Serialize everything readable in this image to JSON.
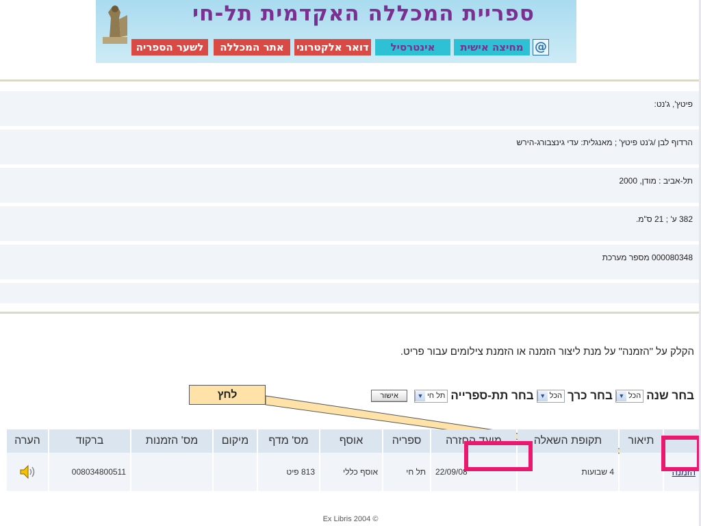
{
  "banner": {
    "title": "ספריית המכללה האקדמית תל-חי",
    "nav": [
      "לשער הספריה",
      "אתר המכללה",
      "דואר אלקטרוני",
      "אינטרסיל",
      "מחיצה אישית"
    ],
    "at_symbol": "@"
  },
  "record": {
    "author": "פיטץ', ג'נט:",
    "title_statement": "הרדוף לבן /ג'נט פיטץ' ; מאנגלית: עדי גינצבורג-הירש",
    "publication": "תל-אביב : מודן, 2000",
    "physical": "382 ע' ; 21 ס\"מ.",
    "system_number": "000080348 מספר מערכת"
  },
  "instructions": "הקלק על \"הזמנה\" על מנת ליצור הזמנה או הזמנת צילומים עבור פריט.",
  "filters": {
    "year_label": "בחר שנה",
    "year_value": "הכל",
    "volume_label": "בחר כרך",
    "volume_value": "הכל",
    "sublibrary_label": "בחר תת-ספרייה",
    "sublibrary_value": "תל חי",
    "confirm": "אישור"
  },
  "callout": "לחץ",
  "table": {
    "headers": [
      "",
      "תיאור",
      "תקופת השאלה",
      "מועד החזרה",
      "ספריה",
      "אוסף",
      "מס' מדף",
      "מיקום",
      "מס' הזמנות",
      "ברקוד",
      "הערה"
    ],
    "row": {
      "request_link": "הזמנה",
      "description": "",
      "loan_period": "4 שבועות",
      "due_date": "22/09/08",
      "library": "תל חי",
      "collection": "אוסף כללי",
      "shelf": "813 פיט",
      "location": "",
      "requests": "",
      "barcode": "008034800511",
      "note": ""
    }
  },
  "footer": "Ex Libris 2004 ©",
  "colors": {
    "banner_title": "#7b2f90",
    "nav_red": "#d84a43",
    "nav_aqua": "#2ec1d6",
    "highlight": "#e8196f",
    "callout_bg": "#ffe2a8",
    "header_bg": "#dbe5ef",
    "row_bg": "#f1f5f9"
  },
  "icons": {
    "speaker": "speaker-icon",
    "statue": "statue-logo-icon"
  }
}
